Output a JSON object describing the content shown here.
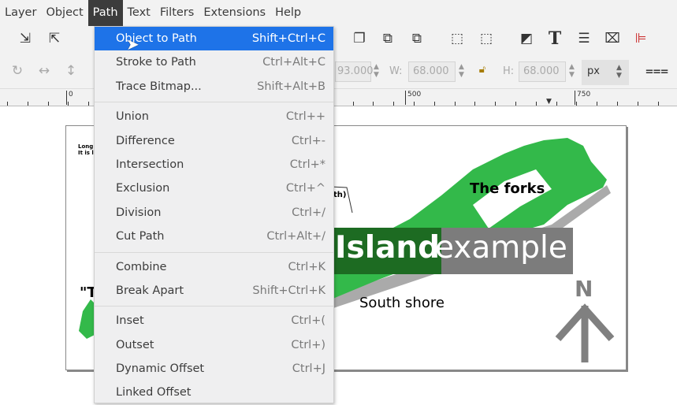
{
  "menubar": {
    "items": [
      "Layer",
      "Object",
      "Path",
      "Text",
      "Filters",
      "Extensions",
      "Help"
    ],
    "active": "Path"
  },
  "toolbar2": {
    "x_value": "93.000",
    "w_label": "W:",
    "w_value": "68.000",
    "h_label": "H:",
    "h_value": "68.000",
    "unit": "px"
  },
  "ruler": {
    "labels": [
      "0",
      "500",
      "750"
    ]
  },
  "path_menu": {
    "groups": [
      [
        {
          "label": "Object to Path",
          "shortcut": "Shift+Ctrl+C",
          "highlighted": true
        },
        {
          "label": "Stroke to Path",
          "shortcut": "Ctrl+Alt+C"
        },
        {
          "label": "Trace Bitmap...",
          "shortcut": "Shift+Alt+B"
        }
      ],
      [
        {
          "label": "Union",
          "shortcut": "Ctrl++"
        },
        {
          "label": "Difference",
          "shortcut": "Ctrl+-"
        },
        {
          "label": "Intersection",
          "shortcut": "Ctrl+*"
        },
        {
          "label": "Exclusion",
          "shortcut": "Ctrl+^"
        },
        {
          "label": "Division",
          "shortcut": "Ctrl+/"
        },
        {
          "label": "Cut Path",
          "shortcut": "Ctrl+Alt+/"
        }
      ],
      [
        {
          "label": "Combine",
          "shortcut": "Ctrl+K"
        },
        {
          "label": "Break Apart",
          "shortcut": "Shift+Ctrl+K"
        }
      ],
      [
        {
          "label": "Inset",
          "shortcut": "Ctrl+("
        },
        {
          "label": "Outset",
          "shortcut": "Ctrl+)"
        },
        {
          "label": "Dynamic Offset",
          "shortcut": "Ctrl+J"
        },
        {
          "label": "Linked Offset",
          "shortcut": ""
        }
      ]
    ]
  },
  "canvas": {
    "small_text_1": "Long",
    "small_text_2": "It is l",
    "callout": "th)",
    "quote": "\"T",
    "title_bold": "Island",
    "title_light": "example",
    "label_forks": "The forks",
    "label_south": "South shore",
    "north": "N"
  },
  "colors": {
    "highlight": "#1e73e8",
    "green": "#33b94a",
    "dark_green": "#1d6b22",
    "gray": "#7c7c7c"
  }
}
